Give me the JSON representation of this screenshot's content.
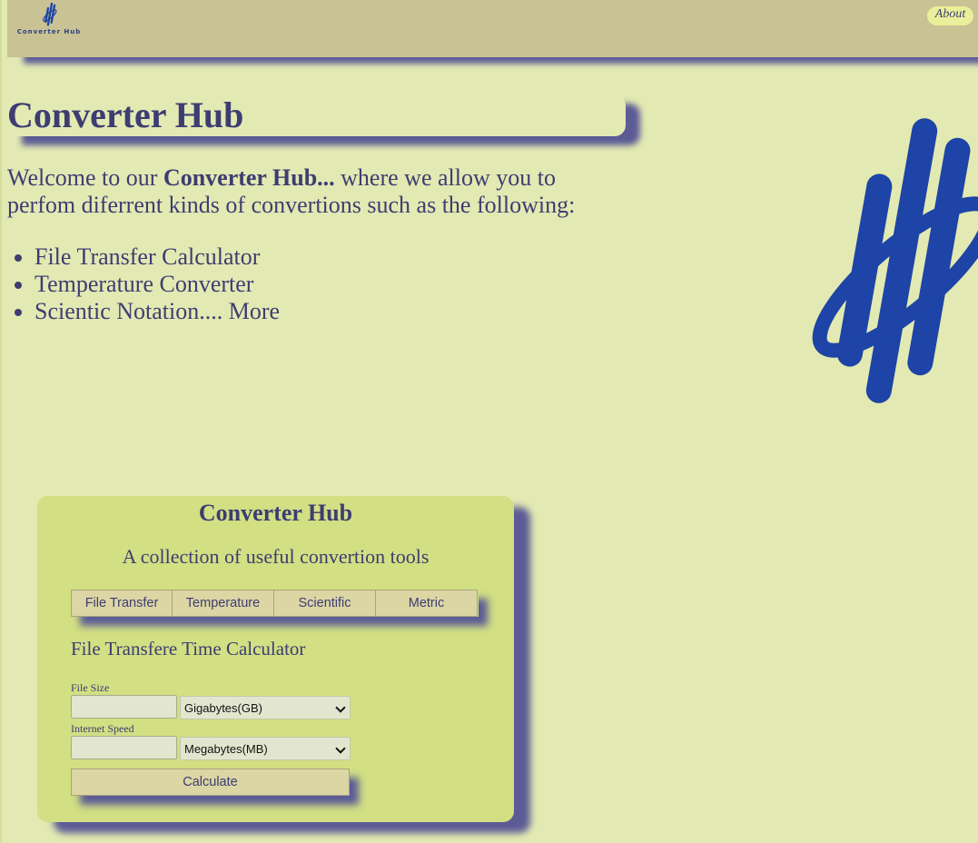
{
  "header": {
    "logo_text": "Converter Hub",
    "about_label": "About"
  },
  "hero": {
    "title": "Converter Hub",
    "welcome_prefix": "Welcome to our ",
    "welcome_bold": "Converter Hub...",
    "welcome_suffix": " where we allow you to perfom diferrent kinds of convertions such as the following:",
    "features": [
      "File Transfer Calculator",
      "Temperature Converter",
      "Scientic Notation.... More"
    ]
  },
  "card": {
    "title": "Converter Hub",
    "subtitle": "A collection of useful convertion tools",
    "tabs": [
      "File Transfer",
      "Temperature",
      "Scientific",
      "Metric"
    ],
    "tool_title": "File Transfere Time Calculator",
    "file_size": {
      "label": "File Size",
      "value": "",
      "unit": "Gigabytes(GB)"
    },
    "internet_speed": {
      "label": "Internet Speed",
      "value": "",
      "unit": "Megabytes(MB)"
    },
    "calculate_label": "Calculate"
  },
  "colors": {
    "background": "#e3e9b2",
    "header": "#c8c294",
    "card": "#d2df83",
    "text": "#3d3d72",
    "shadow": "#5b5b96",
    "logo_blue": "#1d44a6",
    "button": "#dcd5a4"
  },
  "icons": {
    "logo": "converter-hub-logo-icon",
    "select": "chevron-down-icon"
  }
}
